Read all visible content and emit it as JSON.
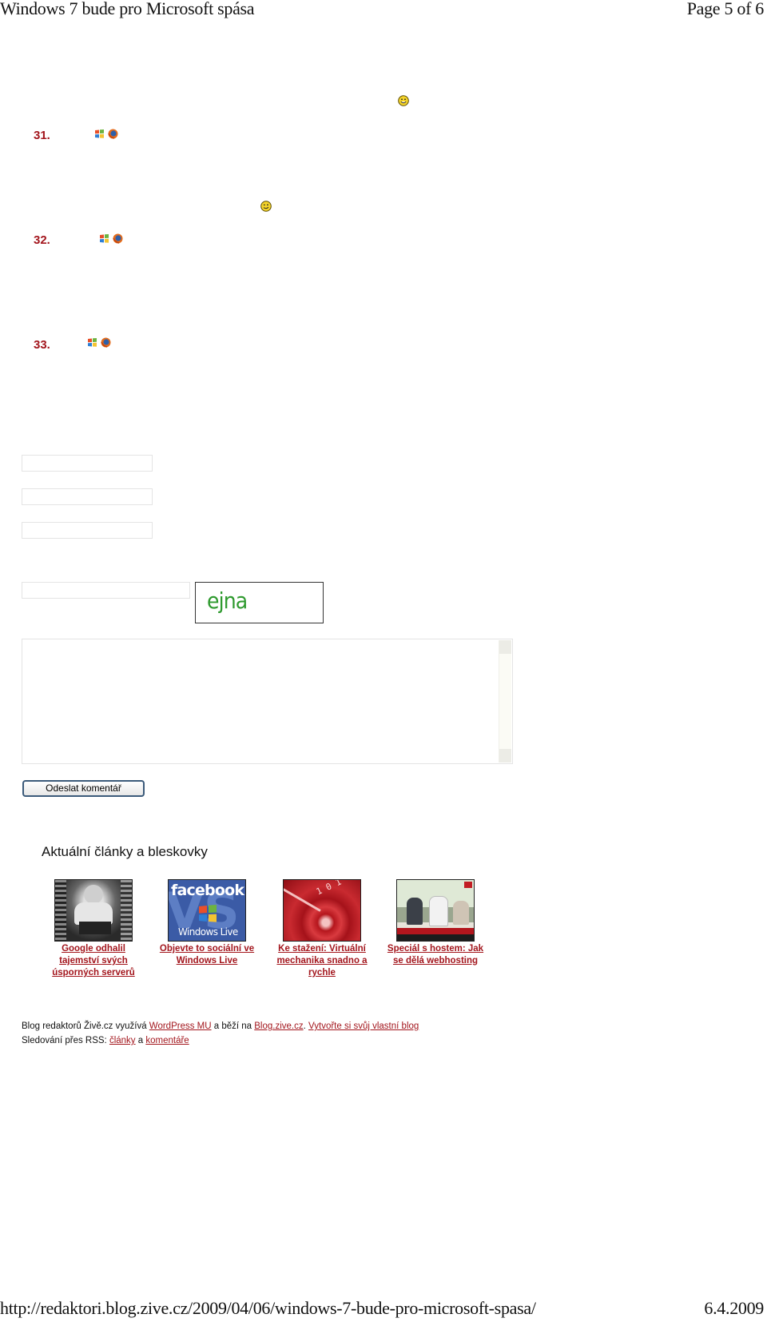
{
  "page_header": {
    "title": "Windows 7 bude pro Microsoft spása",
    "page_indicator": "Page 5 of 6"
  },
  "comments": [
    {
      "number": "31.",
      "os_icon": "windows-icon",
      "browser_icon": "firefox-icon"
    },
    {
      "number": "32.",
      "os_icon": "windows-icon",
      "browser_icon": "firefox-icon"
    },
    {
      "number": "33.",
      "os_icon": "windows-icon",
      "browser_icon": "firefox-icon"
    }
  ],
  "smileys": [
    "smile-icon",
    "wink-icon"
  ],
  "comment_form": {
    "name_value": "",
    "email_value": "",
    "website_value": "",
    "captcha_value": "",
    "captcha_image_text": "ejna",
    "comment_value": "",
    "submit_label": "Odeslat komentář"
  },
  "news_section": {
    "title": "Aktuální články a bleskovky",
    "items": [
      {
        "label": "Google odhalil tajemství svých úsporných serverů",
        "thumb": "server-photo"
      },
      {
        "label": "Objevte to sociální ve Windows Live",
        "thumb": "facebook-vs-windows-live"
      },
      {
        "label": "Ke stažení: Virtuální mechanika snadno a rychle",
        "thumb": "red-cd-disc"
      },
      {
        "label": "Speciál s hostem: Jak se dělá webhosting",
        "thumb": "video-interview"
      }
    ]
  },
  "footer": {
    "line1_prefix": "Blog redaktorů Živě.cz využívá ",
    "link_wordpress": "WordPress MU",
    "line1_mid": " a běží na ",
    "link_blog": "Blog.zive.cz",
    "line1_sep": ". ",
    "link_create": "Vytvořte si svůj vlastní blog",
    "line2_prefix": "Sledování přes RSS: ",
    "link_articles": "články",
    "line2_mid": " a ",
    "link_comments": "komentáře"
  },
  "print_footer": {
    "url": "http://redaktori.blog.zive.cz/2009/04/06/windows-7-bude-pro-microsoft-spasa/",
    "date": "6.4.2009"
  },
  "colors": {
    "accent_red": "#a3161d",
    "captcha_green": "#2f9a2f"
  }
}
